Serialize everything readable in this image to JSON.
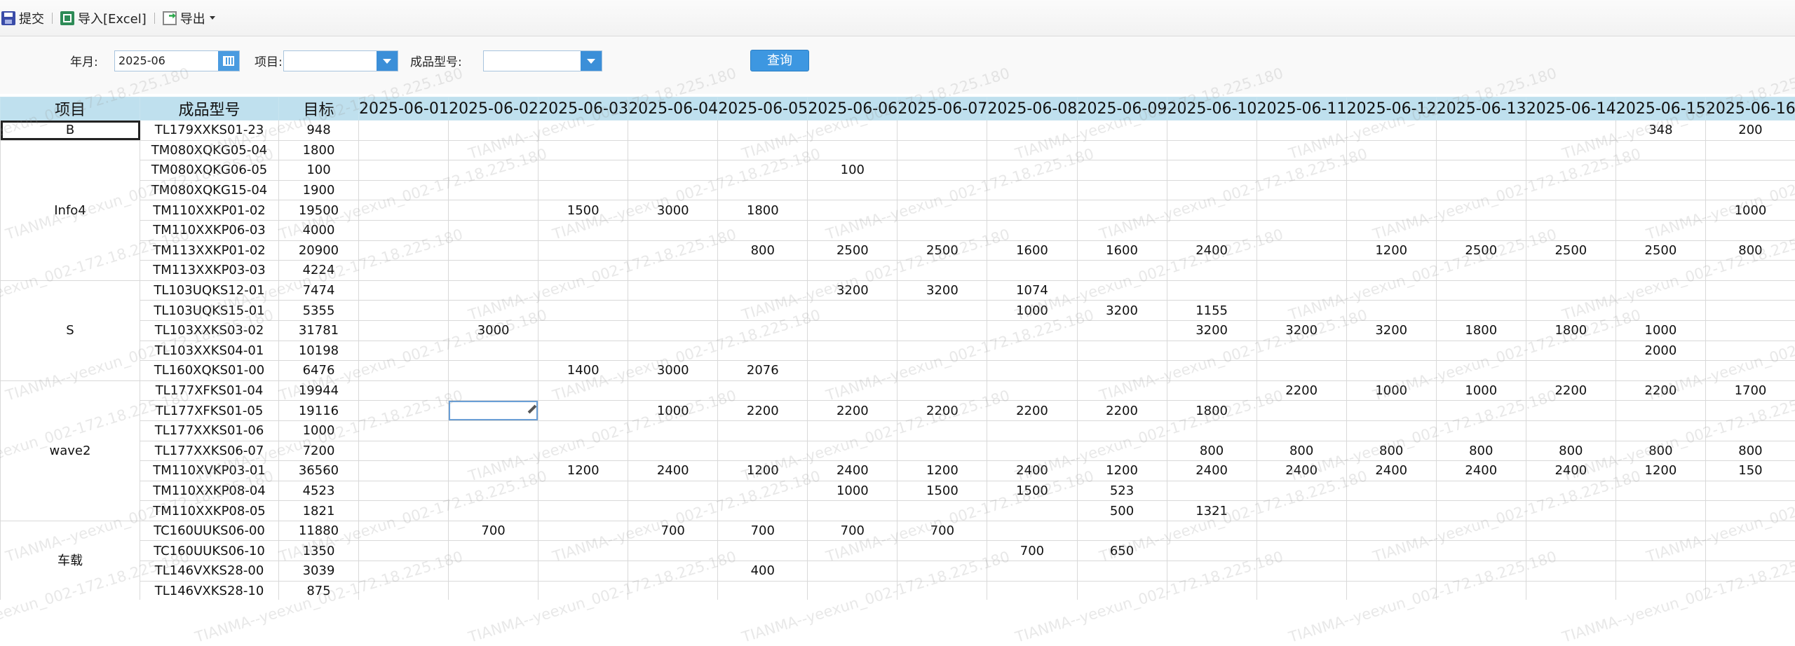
{
  "toolbar": {
    "submit_label": "提交",
    "import_label": "导入[Excel]",
    "export_label": "导出"
  },
  "filter": {
    "month_label": "年月:",
    "month_value": "2025-06",
    "project_label": "项目:",
    "project_value": "",
    "model_label": "成品型号:",
    "model_value": "",
    "query_label": "查询"
  },
  "grid": {
    "headers": {
      "project": "项目",
      "model": "成品型号",
      "target": "目标",
      "dates": [
        "2025-06-01",
        "2025-06-02",
        "2025-06-03",
        "2025-06-04",
        "2025-06-05",
        "2025-06-06",
        "2025-06-07",
        "2025-06-08",
        "2025-06-09",
        "2025-06-10",
        "2025-06-11",
        "2025-06-12",
        "2025-06-13",
        "2025-06-14",
        "2025-06-15",
        "2025-06-16"
      ]
    },
    "groups": [
      {
        "project": "B",
        "rows": [
          {
            "model": "TL179XXKS01-23",
            "target": "948",
            "values": [
              "",
              "",
              "",
              "",
              "",
              "",
              "",
              "",
              "",
              "",
              "",
              "",
              "",
              "",
              "348",
              "200"
            ]
          }
        ]
      },
      {
        "project": "Info4",
        "rows": [
          {
            "model": "TM080XQKG05-04",
            "target": "1800",
            "values": [
              "",
              "",
              "",
              "",
              "",
              "",
              "",
              "",
              "",
              "",
              "",
              "",
              "",
              "",
              "",
              ""
            ]
          },
          {
            "model": "TM080XQKG06-05",
            "target": "100",
            "values": [
              "",
              "",
              "",
              "",
              "",
              "100",
              "",
              "",
              "",
              "",
              "",
              "",
              "",
              "",
              "",
              ""
            ]
          },
          {
            "model": "TM080XQKG15-04",
            "target": "1900",
            "values": [
              "",
              "",
              "",
              "",
              "",
              "",
              "",
              "",
              "",
              "",
              "",
              "",
              "",
              "",
              "",
              ""
            ]
          },
          {
            "model": "TM110XXKP01-02",
            "target": "19500",
            "values": [
              "",
              "",
              "1500",
              "3000",
              "1800",
              "",
              "",
              "",
              "",
              "",
              "",
              "",
              "",
              "",
              "",
              "1000"
            ]
          },
          {
            "model": "TM110XXKP06-03",
            "target": "4000",
            "values": [
              "",
              "",
              "",
              "",
              "",
              "",
              "",
              "",
              "",
              "",
              "",
              "",
              "",
              "",
              "",
              ""
            ]
          },
          {
            "model": "TM113XXKP01-02",
            "target": "20900",
            "values": [
              "",
              "",
              "",
              "",
              "800",
              "2500",
              "2500",
              "1600",
              "1600",
              "2400",
              "",
              "1200",
              "2500",
              "2500",
              "2500",
              "800"
            ]
          },
          {
            "model": "TM113XXKP03-03",
            "target": "4224",
            "values": [
              "",
              "",
              "",
              "",
              "",
              "",
              "",
              "",
              "",
              "",
              "",
              "",
              "",
              "",
              "",
              ""
            ]
          }
        ]
      },
      {
        "project": "S",
        "rows": [
          {
            "model": "TL103UQKS12-01",
            "target": "7474",
            "values": [
              "",
              "",
              "",
              "",
              "",
              "3200",
              "3200",
              "1074",
              "",
              "",
              "",
              "",
              "",
              "",
              "",
              ""
            ]
          },
          {
            "model": "TL103UQKS15-01",
            "target": "5355",
            "values": [
              "",
              "",
              "",
              "",
              "",
              "",
              "",
              "1000",
              "3200",
              "1155",
              "",
              "",
              "",
              "",
              "",
              ""
            ]
          },
          {
            "model": "TL103XXKS03-02",
            "target": "31781",
            "values": [
              "",
              "3000",
              "",
              "",
              "",
              "",
              "",
              "",
              "",
              "3200",
              "3200",
              "3200",
              "1800",
              "1800",
              "1000",
              ""
            ]
          },
          {
            "model": "TL103XXKS04-01",
            "target": "10198",
            "values": [
              "",
              "",
              "",
              "",
              "",
              "",
              "",
              "",
              "",
              "",
              "",
              "",
              "",
              "",
              "2000",
              ""
            ]
          },
          {
            "model": "TL160XQKS01-00",
            "target": "6476",
            "values": [
              "",
              "",
              "1400",
              "3000",
              "2076",
              "",
              "",
              "",
              "",
              "",
              "",
              "",
              "",
              "",
              "",
              ""
            ]
          }
        ]
      },
      {
        "project": "wave2",
        "rows": [
          {
            "model": "TL177XFKS01-04",
            "target": "19944",
            "values": [
              "",
              "",
              "",
              "",
              "",
              "",
              "",
              "",
              "",
              "",
              "2200",
              "1000",
              "1000",
              "2200",
              "2200",
              "1700"
            ]
          },
          {
            "model": "TL177XFKS01-05",
            "target": "19116",
            "values": [
              "",
              "",
              "",
              "1000",
              "2200",
              "2200",
              "2200",
              "2200",
              "2200",
              "1800",
              "",
              "",
              "",
              "",
              "",
              ""
            ]
          },
          {
            "model": "TL177XXKS01-06",
            "target": "1000",
            "values": [
              "",
              "",
              "",
              "",
              "",
              "",
              "",
              "",
              "",
              "",
              "",
              "",
              "",
              "",
              "",
              ""
            ]
          },
          {
            "model": "TL177XXKS06-07",
            "target": "7200",
            "values": [
              "",
              "",
              "",
              "",
              "",
              "",
              "",
              "",
              "",
              "800",
              "800",
              "800",
              "800",
              "800",
              "800",
              "800"
            ]
          },
          {
            "model": "TM110XVKP03-01",
            "target": "36560",
            "values": [
              "",
              "",
              "1200",
              "2400",
              "1200",
              "2400",
              "1200",
              "2400",
              "1200",
              "2400",
              "2400",
              "2400",
              "2400",
              "2400",
              "1200",
              "150"
            ]
          },
          {
            "model": "TM110XXKP08-04",
            "target": "4523",
            "values": [
              "",
              "",
              "",
              "",
              "",
              "1000",
              "1500",
              "1500",
              "523",
              "",
              "",
              "",
              "",
              "",
              "",
              ""
            ]
          },
          {
            "model": "TM110XXKP08-05",
            "target": "1821",
            "values": [
              "",
              "",
              "",
              "",
              "",
              "",
              "",
              "",
              "500",
              "1321",
              "",
              "",
              "",
              "",
              "",
              ""
            ]
          }
        ]
      },
      {
        "project": "车载",
        "rows": [
          {
            "model": "TC160UUKS06-00",
            "target": "11880",
            "values": [
              "",
              "700",
              "",
              "700",
              "700",
              "700",
              "700",
              "",
              "",
              "",
              "",
              "",
              "",
              "",
              "",
              ""
            ]
          },
          {
            "model": "TC160UUKS06-10",
            "target": "1350",
            "values": [
              "",
              "",
              "",
              "",
              "",
              "",
              "",
              "700",
              "650",
              "",
              "",
              "",
              "",
              "",
              "",
              ""
            ]
          },
          {
            "model": "TL146VXKS28-00",
            "target": "3039",
            "values": [
              "",
              "",
              "",
              "",
              "400",
              "",
              "",
              "",
              "",
              "",
              "",
              "",
              "",
              "",
              "",
              ""
            ]
          },
          {
            "model": "TL146VXKS28-10",
            "target": "875",
            "values": [
              "",
              "",
              "",
              "",
              "",
              "",
              "",
              "",
              "",
              "",
              "",
              "",
              "",
              "",
              "",
              ""
            ]
          }
        ]
      }
    ]
  },
  "watermark": "TIANMA--yeexun_002-172.18.225.180"
}
